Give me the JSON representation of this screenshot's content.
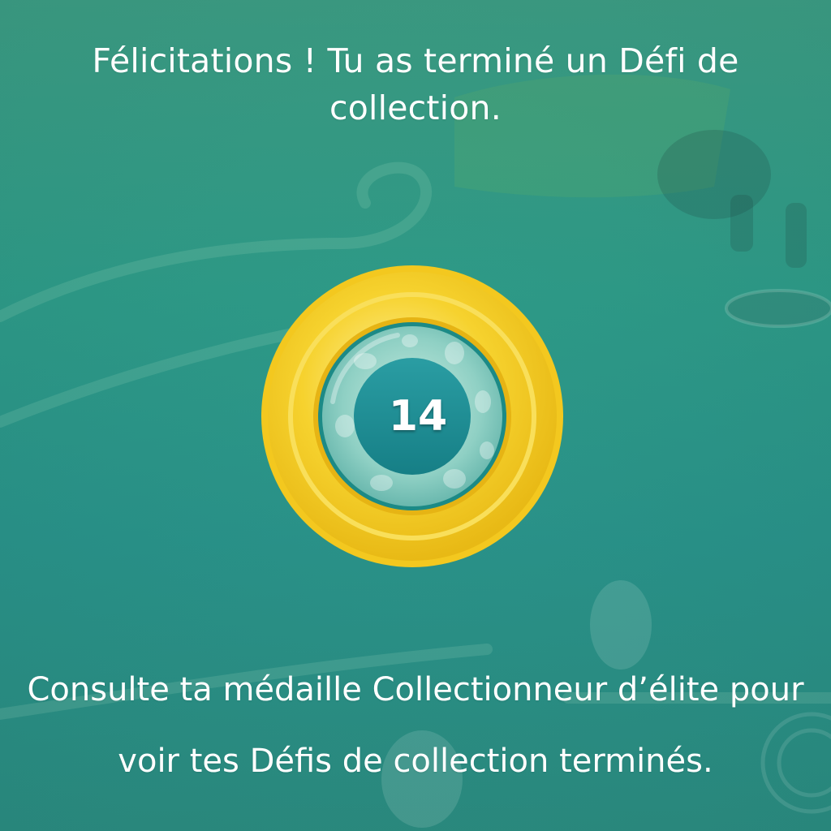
{
  "screen": {
    "title": "Félicitations ! Tu as terminé un Défi de collection.",
    "body": "Consulte ta médaille Collectionneur d’élite pour voir tes Défis de collection terminés."
  },
  "medal": {
    "number": "14",
    "tier": "gold",
    "icon": "collector-medal-icon"
  },
  "colors": {
    "background": "#2f9a87",
    "medal_gold": "#f7d43a",
    "medal_inner": "#1f8a8f",
    "text": "#ffffff"
  }
}
